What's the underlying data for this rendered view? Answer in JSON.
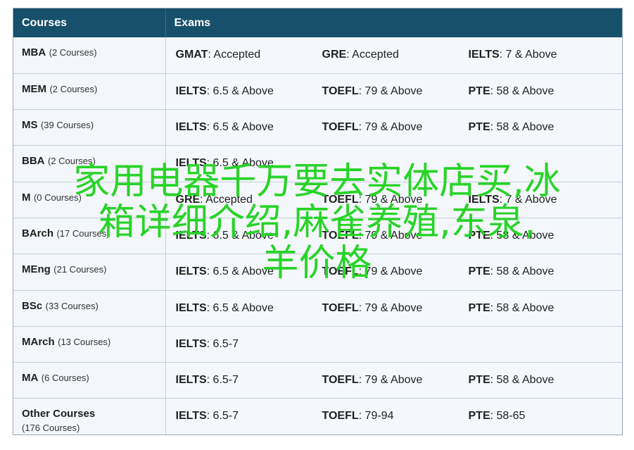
{
  "table": {
    "headers": {
      "courses": "Courses",
      "exams": "Exams"
    },
    "rows": [
      {
        "course": "MBA",
        "count": "(2 Courses)",
        "exams": [
          {
            "name": "GMAT",
            "value": ": Accepted"
          },
          {
            "name": "GRE",
            "value": ": Accepted"
          },
          {
            "name": "IELTS",
            "value": ": 7 & Above"
          }
        ]
      },
      {
        "course": "MEM",
        "count": "(2 Courses)",
        "exams": [
          {
            "name": "IELTS",
            "value": ": 6.5 & Above"
          },
          {
            "name": "TOEFL",
            "value": ": 79 & Above"
          },
          {
            "name": "PTE",
            "value": ": 58 & Above"
          }
        ]
      },
      {
        "course": "MS",
        "count": "(39 Courses)",
        "exams": [
          {
            "name": "IELTS",
            "value": ": 6.5 & Above"
          },
          {
            "name": "TOEFL",
            "value": ": 79 & Above"
          },
          {
            "name": "PTE",
            "value": ": 58 & Above"
          }
        ]
      },
      {
        "course": "BBA",
        "count": "(2 Courses)",
        "exams": [
          {
            "name": "IELTS",
            "value": ": 6.5 & Above"
          }
        ]
      },
      {
        "course": "M",
        "count": "(0 Courses)",
        "exams": [
          {
            "name": "GRE",
            "value": ": Accepted"
          },
          {
            "name": "TOEFL",
            "value": ": 79 & Above"
          },
          {
            "name": "IELTS",
            "value": ": 7 & Above"
          }
        ]
      },
      {
        "course": "BArch",
        "count": "(17 Courses)",
        "exams": [
          {
            "name": "IELTS",
            "value": ": 6.5 & Above"
          },
          {
            "name": "TOEFL",
            "value": ": 79 & Above"
          },
          {
            "name": "PTE",
            "value": ": 58 & Above"
          }
        ]
      },
      {
        "course": "MEng",
        "count": "(21 Courses)",
        "exams": [
          {
            "name": "IELTS",
            "value": ": 6.5 & Above"
          },
          {
            "name": "TOEFL",
            "value": ": 79 & Above"
          },
          {
            "name": "PTE",
            "value": ": 58 & Above"
          }
        ]
      },
      {
        "course": "BSc",
        "count": "(33 Courses)",
        "exams": [
          {
            "name": "IELTS",
            "value": ": 6.5 & Above"
          },
          {
            "name": "TOEFL",
            "value": ": 79 & Above"
          },
          {
            "name": "PTE",
            "value": ": 58 & Above"
          }
        ]
      },
      {
        "course": "MArch",
        "count": "(13 Courses)",
        "exams": [
          {
            "name": "IELTS",
            "value": ": 6.5-7"
          }
        ]
      },
      {
        "course": "MA",
        "count": "(6 Courses)",
        "exams": [
          {
            "name": "IELTS",
            "value": ": 6.5-7"
          },
          {
            "name": "TOEFL",
            "value": ": 79 & Above"
          },
          {
            "name": "PTE",
            "value": ": 58 & Above"
          }
        ]
      },
      {
        "course": "Other Courses",
        "count": "(176 Courses)",
        "exams": [
          {
            "name": "IELTS",
            "value": ": 6.5-7"
          },
          {
            "name": "TOEFL",
            "value": ": 79-94"
          },
          {
            "name": "PTE",
            "value": ": 58-65"
          }
        ]
      }
    ]
  },
  "overlay": {
    "lines": [
      "家用电器千万要去实体店买,冰",
      "箱详细介绍,麻雀养殖,东泉,",
      "羊价格"
    ],
    "color": "#28d328"
  },
  "colors": {
    "header_bg": "#17506a",
    "row_bg": "#f4f8fc"
  }
}
